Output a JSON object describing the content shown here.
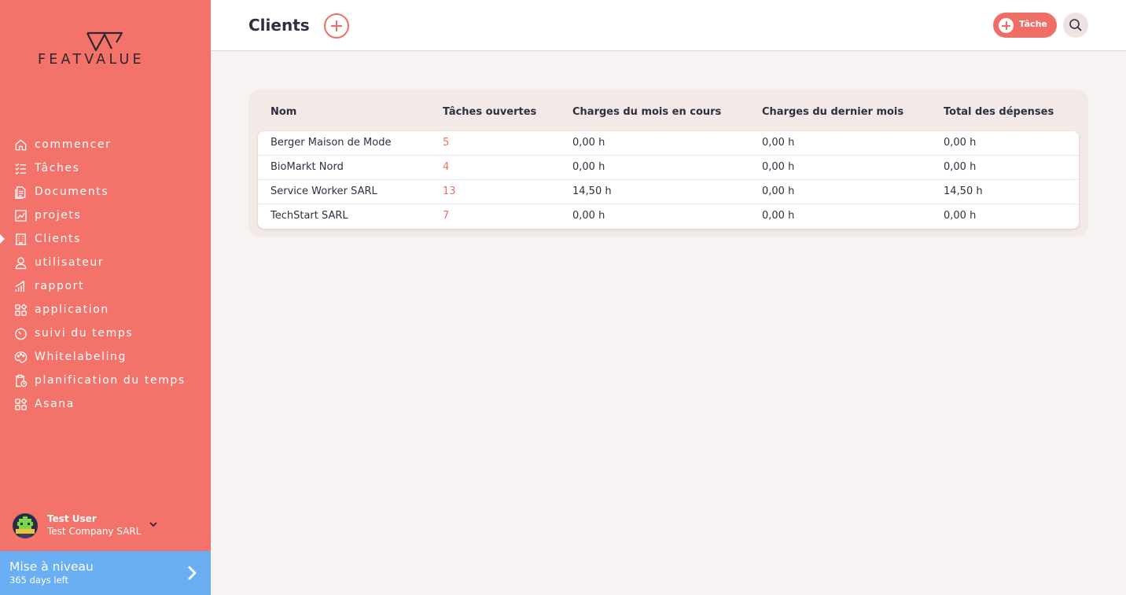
{
  "sidebar": {
    "logo_text": "FEATVALUE",
    "items": [
      {
        "label": "commencer",
        "icon": "home-icon",
        "active": false
      },
      {
        "label": "Tâches",
        "icon": "checklist-icon",
        "active": false
      },
      {
        "label": "Documents",
        "icon": "documents-icon",
        "active": false
      },
      {
        "label": "projets",
        "icon": "chart-icon",
        "active": false
      },
      {
        "label": "Clients",
        "icon": "building-icon",
        "active": true
      },
      {
        "label": "utilisateur",
        "icon": "user-icon",
        "active": false
      },
      {
        "label": "rapport",
        "icon": "bar-chart-icon",
        "active": false
      },
      {
        "label": "application",
        "icon": "apps-icon",
        "active": false
      },
      {
        "label": "suivi du temps",
        "icon": "timer-icon",
        "active": false
      },
      {
        "label": "Whitelabeling",
        "icon": "palette-icon",
        "active": false
      },
      {
        "label": "planification du temps",
        "icon": "clipboard-clock-icon",
        "active": false
      },
      {
        "label": "Asana",
        "icon": "apps-icon",
        "active": false
      }
    ],
    "user": {
      "name": "Test User",
      "company": "Test Company SARL"
    },
    "upgrade": {
      "title": "Mise à niveau",
      "subtitle": "365 days left"
    }
  },
  "header": {
    "title": "Clients",
    "task_button_label": "Tâche"
  },
  "table": {
    "columns": [
      "Nom",
      "Tâches ouvertes",
      "Charges du mois en cours",
      "Charges du dernier mois",
      "Total des dépenses"
    ],
    "rows": [
      [
        "Berger Maison de Mode",
        "5",
        "0,00 h",
        "0,00 h",
        "0,00 h"
      ],
      [
        "BioMarkt Nord",
        "4",
        "0,00 h",
        "0,00 h",
        "0,00 h"
      ],
      [
        "Service Worker SARL",
        "13",
        "14,50 h",
        "0,00 h",
        "14,50 h"
      ],
      [
        "TechStart SARL",
        "7",
        "0,00 h",
        "0,00 h",
        "0,00 h"
      ]
    ]
  },
  "colors": {
    "sidebar": "#f3736a",
    "accent": "#ef6e66",
    "upgrade": "#6aaff3",
    "background": "#f7f3f2",
    "text": "#2c3142"
  }
}
